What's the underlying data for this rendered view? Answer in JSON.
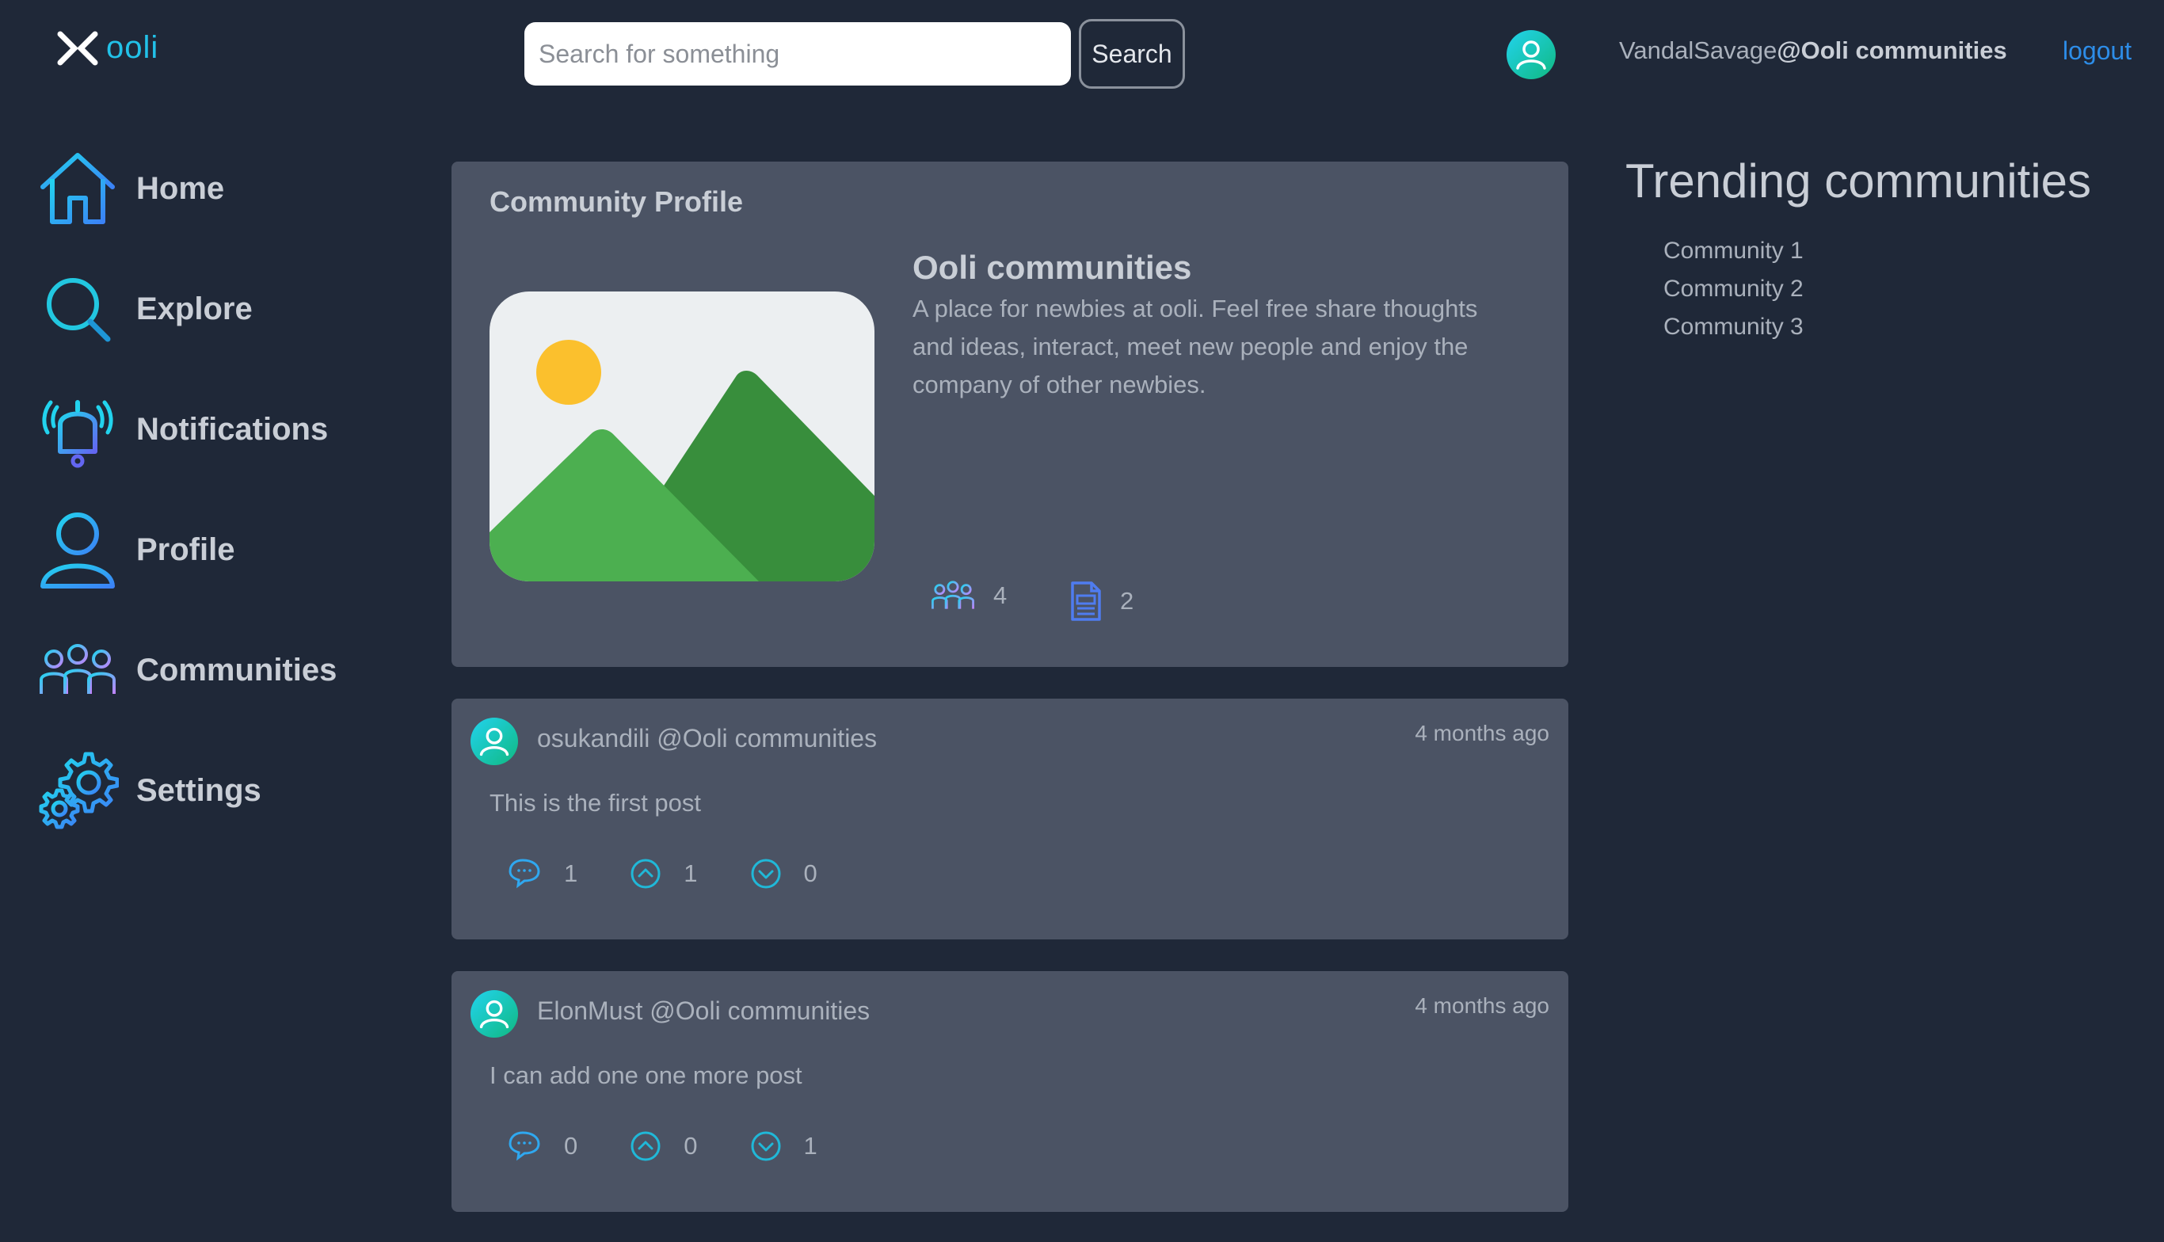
{
  "header": {
    "brand": "ooli",
    "search_placeholder": "Search for something",
    "search_button": "Search",
    "username": "VandalSavage",
    "community_tag": "@Ooli communities",
    "logout": "logout"
  },
  "sidebar": {
    "items": [
      {
        "label": "Home",
        "icon": "home-icon"
      },
      {
        "label": "Explore",
        "icon": "search-icon"
      },
      {
        "label": "Notifications",
        "icon": "bell-icon"
      },
      {
        "label": "Profile",
        "icon": "user-icon"
      },
      {
        "label": "Communities",
        "icon": "group-icon"
      },
      {
        "label": "Settings",
        "icon": "gear-icon"
      }
    ]
  },
  "profile": {
    "title": "Community Profile",
    "name": "Ooli communities",
    "description": "A place for newbies at ooli. Feel free share thoughts and ideas, interact, meet new people and enjoy the company of other newbies.",
    "members": "4",
    "posts": "2"
  },
  "posts": [
    {
      "author": "osukandili @Ooli communities",
      "time": "4 months ago",
      "body": "This is the first post",
      "comments": "1",
      "upvotes": "1",
      "downvotes": "0"
    },
    {
      "author": "ElonMust @Ooli communities",
      "time": "4 months ago",
      "body": "I can add one one more post",
      "comments": "0",
      "upvotes": "0",
      "downvotes": "1"
    }
  ],
  "trending": {
    "title": "Trending communities",
    "items": [
      "Community 1",
      "Community 2",
      "Community 3"
    ]
  },
  "colors": {
    "background": "#1f2838",
    "card": "#4b5364",
    "accent": "#22c1e8",
    "link": "#2d8de8"
  }
}
